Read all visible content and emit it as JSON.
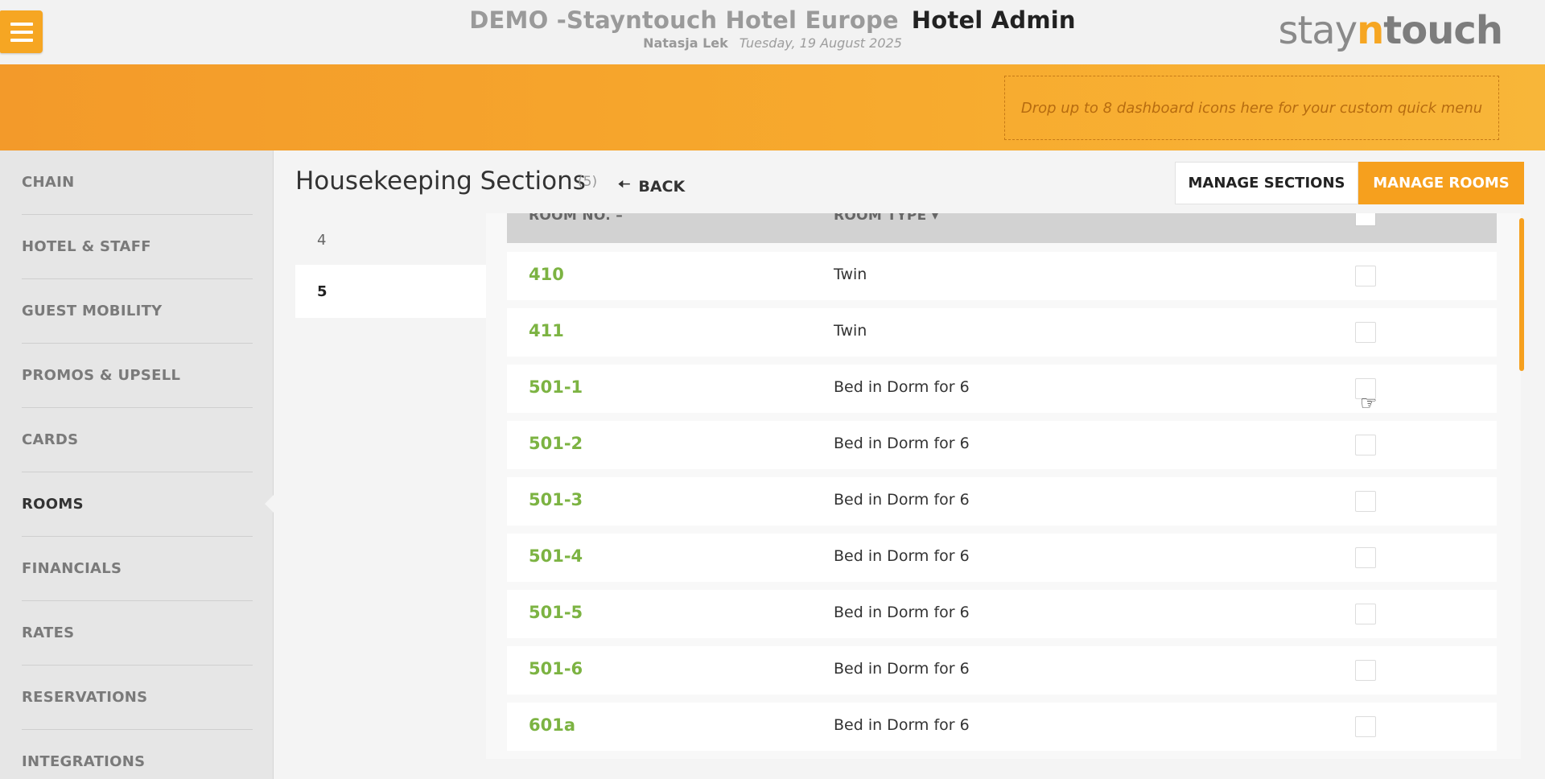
{
  "header": {
    "hotel_name": "DEMO -Stayntouch Hotel Europe",
    "app_name": "Hotel Admin",
    "user_name": "Natasja Lek",
    "date": "Tuesday, 19 August 2025",
    "logo": {
      "part1": "stay",
      "part2": "n",
      "part3": "touch"
    }
  },
  "banner": {
    "dropzone_text": "Drop up to 8 dashboard icons here for your custom quick menu"
  },
  "sidebar": {
    "items": [
      {
        "label": "CHAIN"
      },
      {
        "label": "HOTEL & STAFF"
      },
      {
        "label": "GUEST MOBILITY"
      },
      {
        "label": "PROMOS & UPSELL"
      },
      {
        "label": "CARDS"
      },
      {
        "label": "ROOMS",
        "active": true
      },
      {
        "label": "FINANCIALS"
      },
      {
        "label": "RATES"
      },
      {
        "label": "RESERVATIONS"
      },
      {
        "label": "INTEGRATIONS"
      }
    ]
  },
  "page": {
    "title": "Housekeeping Sections",
    "count": "(5)",
    "back_label": "BACK",
    "manage_sections_label": "MANAGE SECTIONS",
    "manage_rooms_label": "MANAGE ROOMS"
  },
  "sections": [
    {
      "label": "4"
    },
    {
      "label": "5",
      "active": true
    }
  ],
  "table": {
    "columns": [
      "ROOM NO.",
      "ROOM TYPE"
    ],
    "rows": [
      {
        "room_no": "410",
        "room_type": "Twin"
      },
      {
        "room_no": "411",
        "room_type": "Twin"
      },
      {
        "room_no": "501-1",
        "room_type": "Bed in Dorm for 6"
      },
      {
        "room_no": "501-2",
        "room_type": "Bed in Dorm for 6"
      },
      {
        "room_no": "501-3",
        "room_type": "Bed in Dorm for 6"
      },
      {
        "room_no": "501-4",
        "room_type": "Bed in Dorm for 6"
      },
      {
        "room_no": "501-5",
        "room_type": "Bed in Dorm for 6"
      },
      {
        "room_no": "501-6",
        "room_type": "Bed in Dorm for 6"
      },
      {
        "room_no": "601a",
        "room_type": "Bed in Dorm for 6"
      }
    ]
  },
  "colors": {
    "accent": "#f6a01e",
    "room_link": "#7cb342"
  }
}
